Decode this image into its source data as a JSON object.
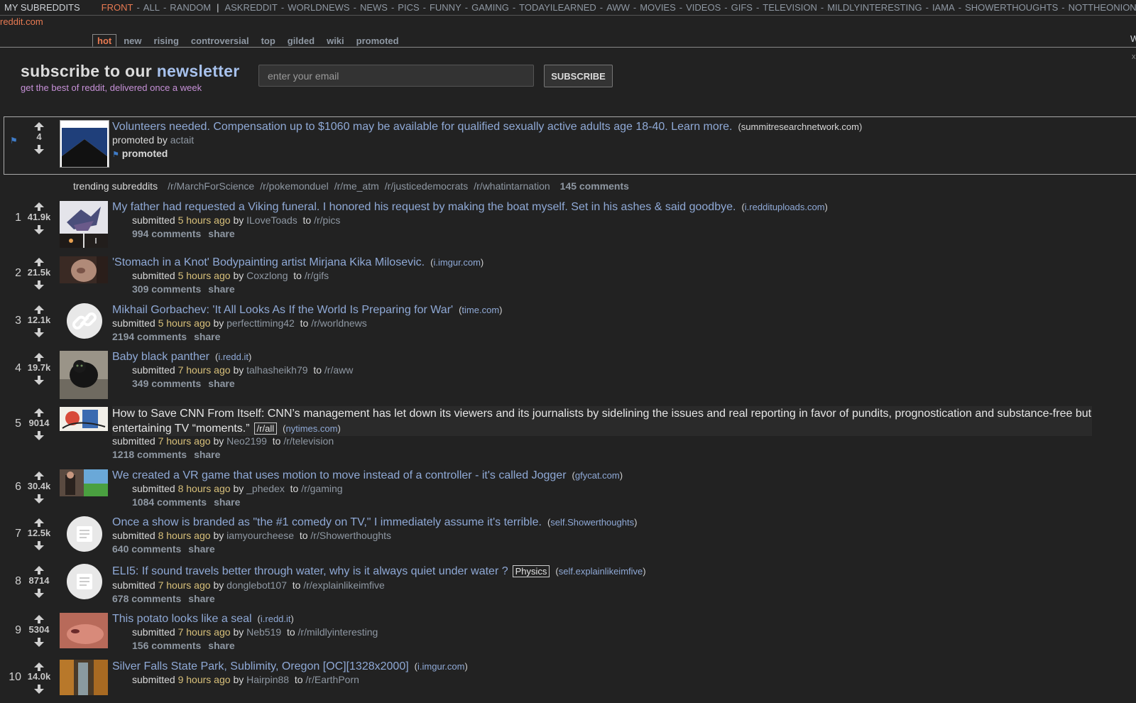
{
  "srbar": {
    "my_subreddits": "MY SUBREDDITS",
    "items": [
      "FRONT",
      "ALL",
      "RANDOM",
      "ASKREDDIT",
      "WORLDNEWS",
      "NEWS",
      "PICS",
      "FUNNY",
      "GAMING",
      "TODAYILEARNED",
      "AWW",
      "MOVIES",
      "VIDEOS",
      "GIFS",
      "TELEVISION",
      "MILDLYINTERESTING",
      "IAMA",
      "SHOWERTHOUGHTS",
      "NOTTHEONION"
    ]
  },
  "site_name": "reddit.com",
  "tabs": [
    "hot",
    "new",
    "rising",
    "controversial",
    "top",
    "gilded",
    "wiki",
    "promoted"
  ],
  "right_cut": "W",
  "right_x": "x",
  "newsletter": {
    "title_a": "subscribe to our",
    "title_b": "newsletter",
    "subtitle": "get the best of reddit, delivered once a week",
    "placeholder": "enter your email",
    "button": "SUBSCRIBE"
  },
  "promoted": {
    "score": "4",
    "title": "Volunteers needed. Compensation up to $1060 may be available for qualified sexually active adults age 18-40. Learn more.",
    "domain": "summitresearchnetwork.com",
    "promoted_by": "promoted by",
    "author": "actait",
    "label": "promoted"
  },
  "trending": {
    "label": "trending subreddits",
    "subs": [
      "/r/MarchForScience",
      "/r/pokemonduel",
      "/r/me_atm",
      "/r/justicedemocrats",
      "/r/whatintarnation"
    ],
    "comments": "145 comments"
  },
  "labels": {
    "submitted": "submitted",
    "by": "by",
    "to": "to",
    "share": "share"
  },
  "posts": [
    {
      "rank": "1",
      "score": "41.9k",
      "title": "My father had requested a Viking funeral. I honored his request by making the boat myself. Set in his ashes & said goodbye.",
      "domain": "i.reddituploads.com",
      "time": "5 hours ago",
      "author": "ILoveToads",
      "sub": "/r/pics",
      "comments": "994 comments"
    },
    {
      "rank": "2",
      "score": "21.5k",
      "title": "'Stomach in a Knot' Bodypainting artist Mirjana Kika Milosevic.",
      "domain": "i.imgur.com",
      "time": "5 hours ago",
      "author": "Coxzlong",
      "sub": "/r/gifs",
      "comments": "309 comments"
    },
    {
      "rank": "3",
      "score": "12.1k",
      "title": "Mikhail Gorbachev: 'It All Looks As If the World Is Preparing for War'",
      "domain": "time.com",
      "time": "5 hours ago",
      "author": "perfecttiming42",
      "sub": "/r/worldnews",
      "comments": "2194 comments"
    },
    {
      "rank": "4",
      "score": "19.7k",
      "title": "Baby black panther",
      "domain": "i.redd.it",
      "time": "7 hours ago",
      "author": "talhasheikh79",
      "sub": "/r/aww",
      "comments": "349 comments"
    },
    {
      "rank": "5",
      "score": "9014",
      "title": "How to Save CNN From Itself: CNN’s management has let down its viewers and its journalists by sidelining the issues and real reporting in favor of pundits, prognostication and substance-free but entertaining TV “moments.”",
      "flair": "/r/all",
      "domain": "nytimes.com",
      "time": "7 hours ago",
      "author": "Neo2199",
      "sub": "/r/television",
      "comments": "1218 comments"
    },
    {
      "rank": "6",
      "score": "30.4k",
      "title": "We created a VR game that uses motion to move instead of a controller - it's called Jogger",
      "domain": "gfycat.com",
      "time": "8 hours ago",
      "author": "_phedex",
      "sub": "/r/gaming",
      "comments": "1084 comments"
    },
    {
      "rank": "7",
      "score": "12.5k",
      "title": "Once a show is branded as \"the #1 comedy on TV,\" I immediately assume it's terrible.",
      "domain": "self.Showerthoughts",
      "time": "8 hours ago",
      "author": "iamyourcheese",
      "sub": "/r/Showerthoughts",
      "comments": "640 comments"
    },
    {
      "rank": "8",
      "score": "8714",
      "title": "ELI5: If sound travels better through water, why is it always quiet under water ?",
      "flair": "Physics",
      "domain": "self.explainlikeimfive",
      "time": "7 hours ago",
      "author": "donglebot107",
      "sub": "/r/explainlikeimfive",
      "comments": "678 comments"
    },
    {
      "rank": "9",
      "score": "5304",
      "title": "This potato looks like a seal",
      "domain": "i.redd.it",
      "time": "7 hours ago",
      "author": "Neb519",
      "sub": "/r/mildlyinteresting",
      "comments": "156 comments"
    },
    {
      "rank": "10",
      "score": "14.0k",
      "title": "Silver Falls State Park, Sublimity, Oregon [OC][1328x2000]",
      "domain": "i.imgur.com",
      "time": "9 hours ago",
      "author": "Hairpin88",
      "sub": "/r/EarthPorn"
    }
  ]
}
